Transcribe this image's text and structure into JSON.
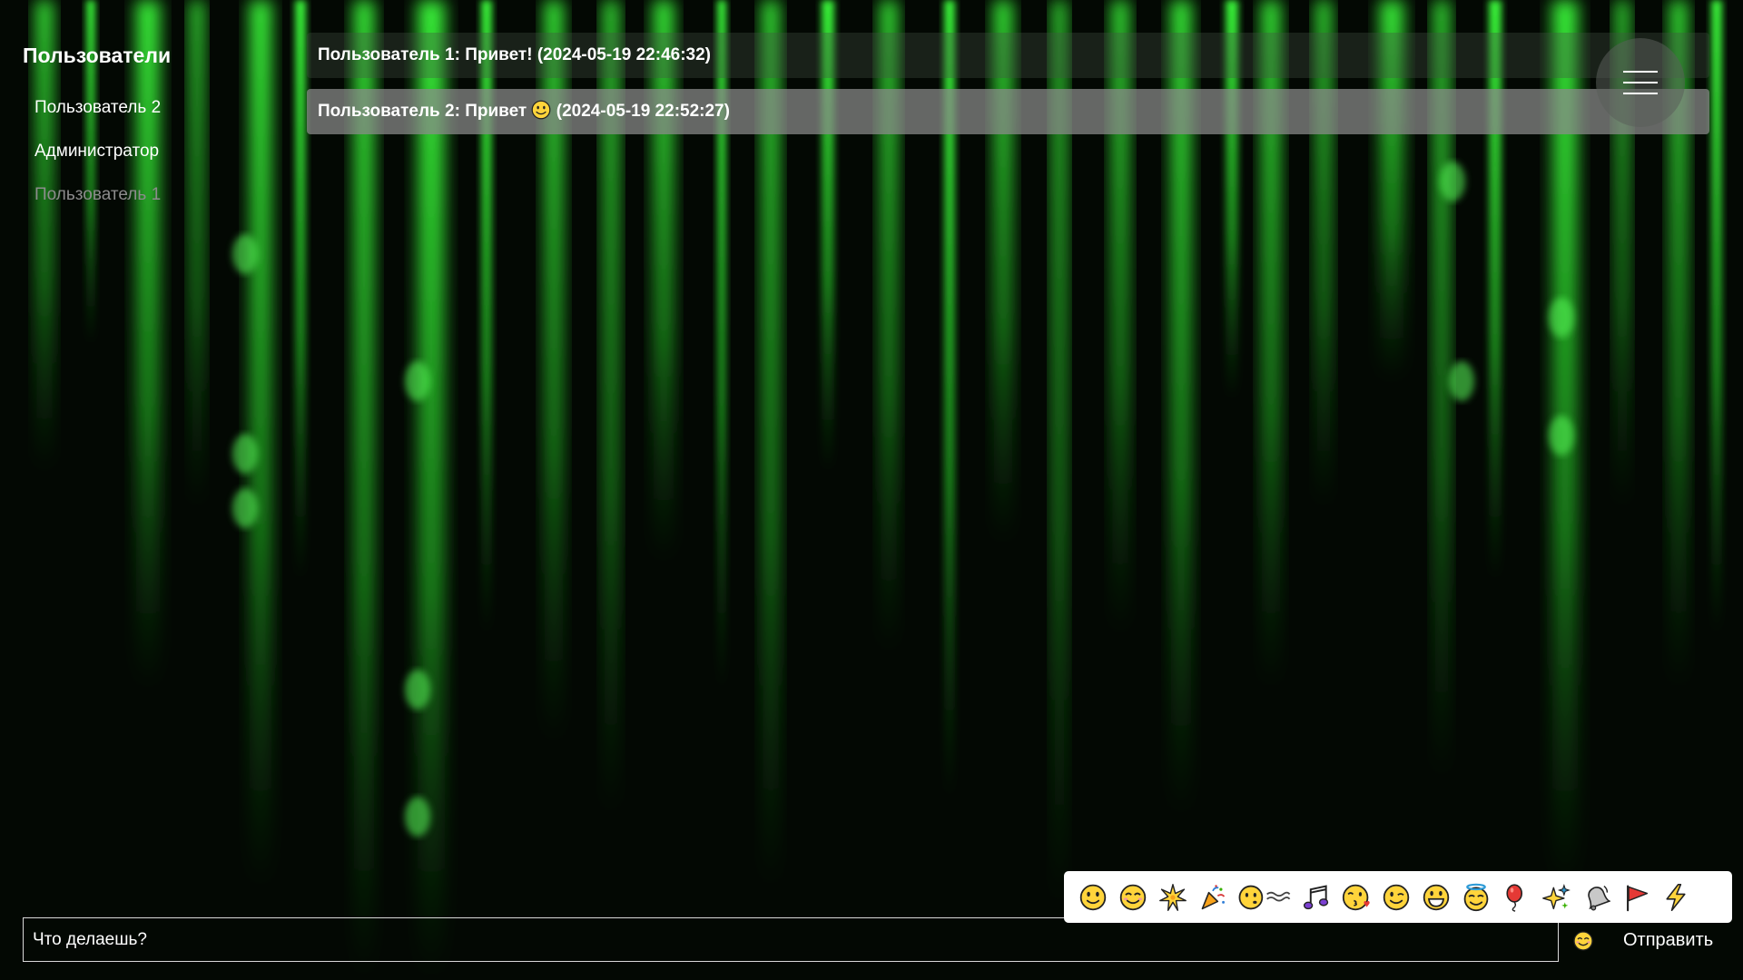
{
  "colors": {
    "background": "#030803",
    "matrix_green": "#39ff3a",
    "text": "#ffffff",
    "muted_text": "#8c8c8c",
    "emoji_yellow": "#ffd43b"
  },
  "sidebar": {
    "title": "Пользователи",
    "users": [
      {
        "name": "Пользователь 2",
        "state": "normal"
      },
      {
        "name": "Администратор",
        "state": "normal"
      },
      {
        "name": "Пользователь 1",
        "state": "current"
      }
    ]
  },
  "messages": [
    {
      "author": "Пользователь 1",
      "text": "Привет!",
      "emoji": "",
      "timestamp": "(2024-05-19 22:46:32)"
    },
    {
      "author": "Пользователь 2",
      "text": "Привет",
      "emoji": "slightly-smiling-face",
      "timestamp": "(2024-05-19 22:52:27)"
    }
  ],
  "menu": {
    "icon": "hamburger-menu-icon"
  },
  "emoji_picker": {
    "items": [
      "slightly-smiling-face",
      "smiling-face-with-smiling-eyes",
      "sparkle-burst",
      "party-popper",
      "face-exhaling",
      "musical-notes",
      "face-blowing-kiss",
      "winking-face",
      "grinning-face",
      "smiling-face-with-halo",
      "balloon",
      "sparkles",
      "bell",
      "triangular-flag",
      "high-voltage"
    ]
  },
  "composer": {
    "input_value": "Что делаешь?",
    "emoji_toggle_icon": "smiling-face-icon",
    "send_label": "Отправить"
  }
}
